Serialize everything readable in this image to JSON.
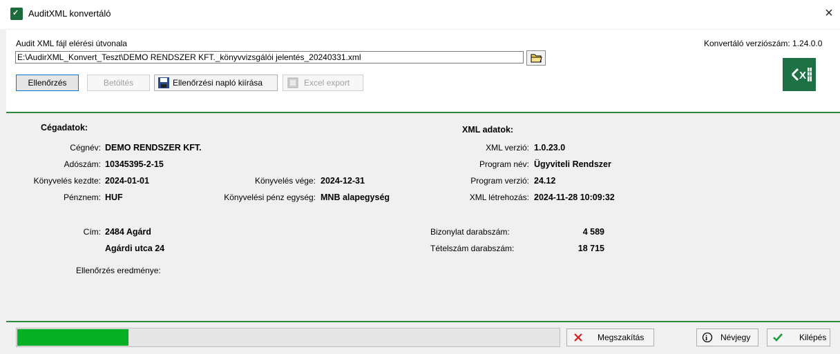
{
  "window": {
    "title": "AuditXML konvertáló",
    "close": "×"
  },
  "top": {
    "path_label": "Audit XML fájl elérési útvonala",
    "version_text": "Konvertáló verziószám: 1.24.0.0",
    "path_value": "E:\\AudirXML_Konvert_Teszt\\DEMO RENDSZER KFT._könyvvizsgálói jelentés_20240331.xml",
    "buttons": {
      "check": "Ellenőrzés",
      "load": "Betöltés",
      "log": "Ellenőrzési napló kiírása",
      "excel": "Excel export"
    }
  },
  "company": {
    "heading": "Cégadatok:",
    "name_label": "Cégnév:",
    "name_value": "DEMO RENDSZER KFT.",
    "tax_label": "Adószám:",
    "tax_value": "10345395-2-15",
    "start_label": "Könyvelés kezdte:",
    "start_value": "2024-01-01",
    "end_label": "Könyvelés vége:",
    "end_value": "2024-12-31",
    "currency_label": "Pénznem:",
    "currency_value": "HUF",
    "unit_label": "Könyvelési pénz egység:",
    "unit_value": "MNB alapegység",
    "address_label": "Cím:",
    "address_line1": "2484 Agárd",
    "address_line2": "Agárdi utca 24",
    "result_label": "Ellenőrzés eredménye:"
  },
  "xml": {
    "heading": "XML adatok:",
    "version_label": "XML verzió:",
    "version_value": "1.0.23.0",
    "program_label": "Program név:",
    "program_value": "Ügyviteli Rendszer",
    "progver_label": "Program verzió:",
    "progver_value": "24.12",
    "created_label": "XML létrehozás:",
    "created_value": "2024-11-28 10:09:32",
    "docs_label": "Bizonylat darabszám:",
    "docs_value": "4 589",
    "items_label": "Tételszám darabszám:",
    "items_value": "18 715"
  },
  "bottom": {
    "progress": 0.205,
    "cancel": "Megszakítás",
    "about": "Névjegy",
    "exit": "Kilépés"
  },
  "colors": {
    "accent": "#2e8b3e",
    "progress": "#06b025",
    "excel": "#1e7145"
  }
}
